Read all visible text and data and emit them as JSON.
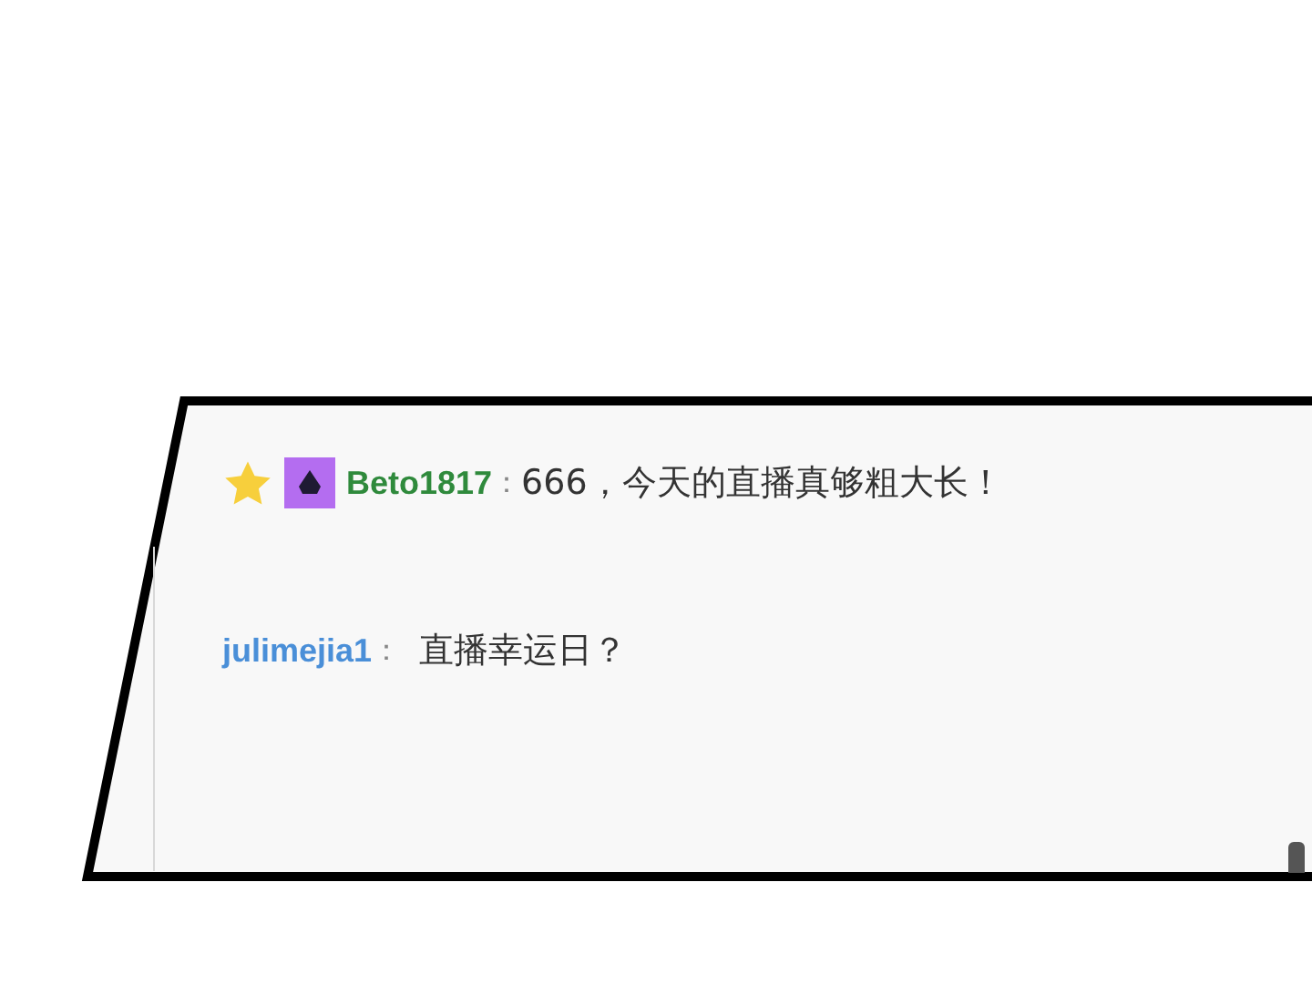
{
  "chat": {
    "messages": [
      {
        "kind": "vip",
        "user": "Beto1817",
        "color": "#2f8a3c",
        "separator": "：",
        "text": "666，今天的直播真够粗大长！"
      },
      {
        "kind": "plain",
        "user": "julimejia1",
        "color": "#4a8fd8",
        "separator": "：",
        "text": "直播幸运日？"
      }
    ]
  }
}
